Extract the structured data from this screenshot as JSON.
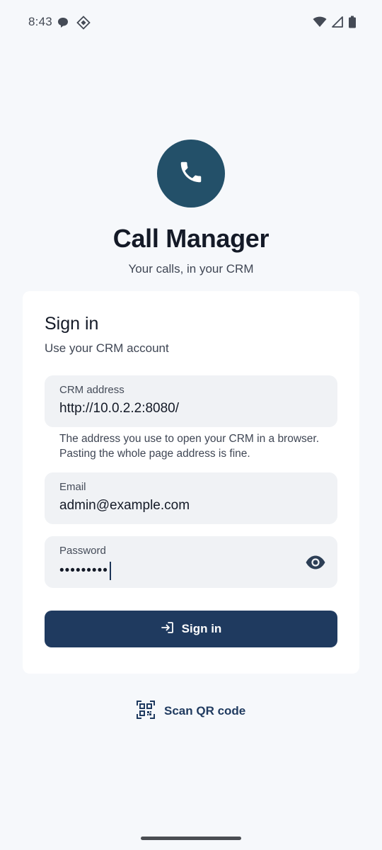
{
  "status_bar": {
    "time": "8:43",
    "left_icons": [
      "chat-bubble-icon",
      "app-diamond-icon"
    ],
    "right_icons": [
      "wifi-icon",
      "cell-signal-icon",
      "battery-icon"
    ]
  },
  "app": {
    "logo_icon": "phone-icon",
    "title": "Call Manager",
    "subtitle": "Your calls, in your CRM",
    "brand_color": "#235069"
  },
  "form": {
    "title": "Sign in",
    "subtitle": "Use your CRM account",
    "crm_address": {
      "label": "CRM address",
      "value": "http://10.0.2.2:8080/"
    },
    "helper_text": "The address you use to open your CRM in a browser. Pasting the whole page address is fine.",
    "email": {
      "label": "Email",
      "value": "admin@example.com"
    },
    "password": {
      "label": "Password",
      "masked_value": "•••••••••",
      "toggle_icon": "eye-icon"
    },
    "submit": {
      "label": "Sign in",
      "icon": "login-icon",
      "color": "#1f3a5f"
    }
  },
  "scan_qr": {
    "label": "Scan QR code",
    "icon": "qr-code-icon"
  }
}
